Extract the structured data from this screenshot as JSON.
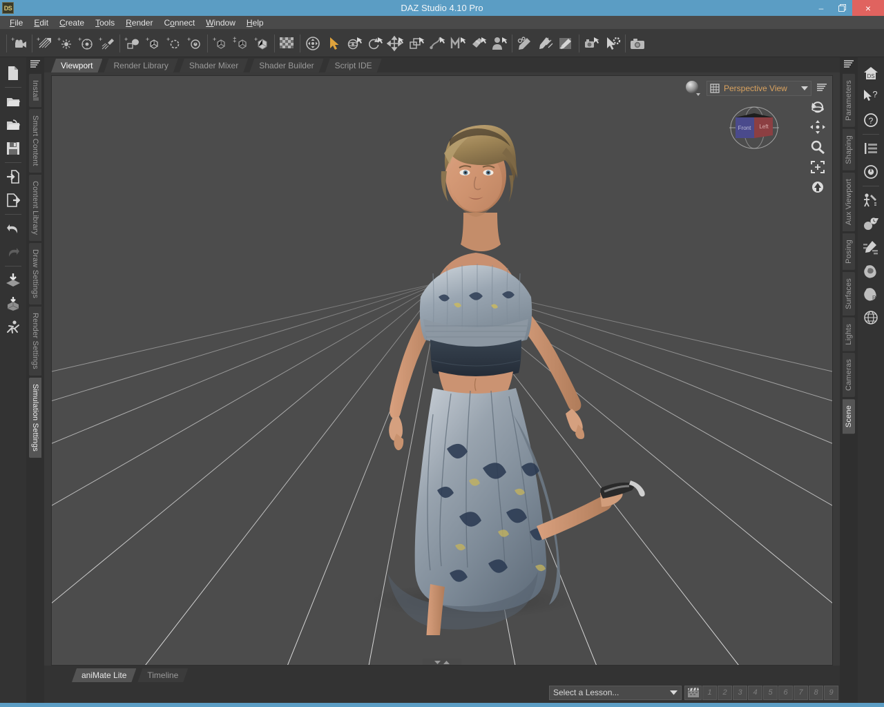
{
  "window": {
    "title": "DAZ Studio 4.10 Pro",
    "logo_text": "DS",
    "minimize": "–",
    "restore": "❐",
    "close": "×"
  },
  "menubar": {
    "items": [
      {
        "label": "File",
        "accel": "F"
      },
      {
        "label": "Edit",
        "accel": "E"
      },
      {
        "label": "Create",
        "accel": "C"
      },
      {
        "label": "Tools",
        "accel": "T"
      },
      {
        "label": "Render",
        "accel": "R"
      },
      {
        "label": "Connect",
        "accel": "o"
      },
      {
        "label": "Window",
        "accel": "W"
      },
      {
        "label": "Help",
        "accel": "H"
      }
    ]
  },
  "toolbar": {
    "groups": [
      [
        "create-camera-icon",
        "create-distant-light-icon",
        "create-point-light-icon",
        "create-spotlight-icon",
        "create-linear-light-icon"
      ],
      [
        "create-primitive-icon",
        "create-node-icon",
        "create-null-icon",
        "create-sphere-icon"
      ],
      [
        "create-group-icon",
        "create-duplicate-icon",
        "create-cube-icon"
      ],
      [
        "texture-grid-icon"
      ],
      [
        "universal-tool-icon",
        "node-selection-tool-icon",
        "rotate-tool-icon",
        "spin-tool-icon",
        "translate-tool-icon",
        "scale-tool-icon",
        "joint-editor-icon",
        "mesh-tool-icon",
        "surface-selection-icon",
        "figure-setup-icon"
      ],
      [
        "geometry-editor-icon",
        "pen-tool-icon",
        "line-tool-icon",
        "node-weight-icon"
      ],
      [
        "render-settings-icon",
        "aux-render-icon"
      ],
      [
        "render-camera-icon"
      ]
    ],
    "active_tool": "node-selection-tool-icon"
  },
  "left_edge_icons": [
    {
      "name": "new-file-icon",
      "enabled": true
    },
    {
      "name": "open-file-icon",
      "enabled": true
    },
    {
      "name": "open-recent-icon",
      "enabled": true
    },
    {
      "name": "save-file-icon",
      "enabled": true
    },
    {
      "name": "import-icon",
      "enabled": true
    },
    {
      "name": "export-icon",
      "enabled": true
    },
    {
      "name": "undo-icon",
      "enabled": true
    },
    {
      "name": "redo-icon",
      "enabled": false
    },
    {
      "name": "merge-scene-icon",
      "enabled": true
    },
    {
      "name": "merge-figure-icon",
      "enabled": true
    },
    {
      "name": "pose-figure-icon",
      "enabled": true
    }
  ],
  "right_edge_icons": [
    {
      "name": "ds-home-icon",
      "label": "DS"
    },
    {
      "name": "help-pointer-icon",
      "label": ""
    },
    {
      "name": "help-circle-icon",
      "label": "?"
    },
    {
      "name": "log-list-icon",
      "label": ""
    },
    {
      "name": "target-icon",
      "label": ""
    },
    {
      "name": "puppeteer-icon",
      "label": ""
    },
    {
      "name": "node-sphere-icon",
      "label": ""
    },
    {
      "name": "property-editor-icon",
      "label": ""
    },
    {
      "name": "muscle-icon",
      "label": ""
    },
    {
      "name": "muscle-power-icon",
      "label": ""
    },
    {
      "name": "globe-icon",
      "label": ""
    }
  ],
  "left_tabs": {
    "menu_icon": "pane-options-icon",
    "items": [
      {
        "label": "Install",
        "active": false
      },
      {
        "label": "Smart Content",
        "active": false
      },
      {
        "label": "Content Library",
        "active": false
      },
      {
        "label": "Draw Settings",
        "active": false
      },
      {
        "label": "Render Settings",
        "active": false
      },
      {
        "label": "Simulation Settings",
        "active": true
      }
    ]
  },
  "right_tabs": {
    "menu_icon": "pane-options-icon",
    "items": [
      {
        "label": "Parameters",
        "active": false
      },
      {
        "label": "Shaping",
        "active": false
      },
      {
        "label": "Aux Viewport",
        "active": false
      },
      {
        "label": "Posing",
        "active": false
      },
      {
        "label": "Surfaces",
        "active": false
      },
      {
        "label": "Lights",
        "active": false
      },
      {
        "label": "Cameras",
        "active": false
      },
      {
        "label": "Scene",
        "active": true
      }
    ]
  },
  "main_tabs": [
    {
      "label": "Viewport",
      "active": true
    },
    {
      "label": "Render Library",
      "active": false
    },
    {
      "label": "Shader Mixer",
      "active": false
    },
    {
      "label": "Shader Builder",
      "active": false
    },
    {
      "label": "Script IDE",
      "active": false
    }
  ],
  "viewport": {
    "view_label": "Perspective View",
    "view_icon": "perspective-grid-icon",
    "drawstyle_icon": "draw-style-sphere-icon",
    "pane_menu_icon": "pane-options-icon",
    "navcube": {
      "front_label": "Front",
      "side_label": "Left",
      "front_color": "#4a4a8c",
      "side_color": "#8c3f42"
    },
    "tools": [
      {
        "name": "orbit-camera-icon"
      },
      {
        "name": "pan-camera-icon"
      },
      {
        "name": "zoom-camera-icon"
      },
      {
        "name": "frame-selection-icon"
      },
      {
        "name": "reset-camera-icon"
      }
    ],
    "collapse_handle": "viewport-collapse-handle",
    "background_color": "#4c4c4c",
    "grid_color": "#c9c9c9",
    "scene_description": "3D female figure in mid-stride wearing an off-shoulder ruffled crop top and long floral maxi skirt with heeled sandals"
  },
  "bottom_tabs": [
    {
      "label": "aniMate Lite",
      "active": true
    },
    {
      "label": "Timeline",
      "active": false
    }
  ],
  "bottom_bar": {
    "lesson_select": "Select a Lesson...",
    "clapper_icon": "film-clapper-icon",
    "lesson_numbers": [
      "1",
      "2",
      "3",
      "4",
      "5",
      "6",
      "7",
      "8",
      "9"
    ],
    "pane_menu_icon": "pane-options-icon"
  },
  "colors": {
    "accent": "#5b9dc4",
    "close_button": "#e0635f",
    "active_tool": "#e0a33c",
    "view_label": "#d9a25f"
  }
}
